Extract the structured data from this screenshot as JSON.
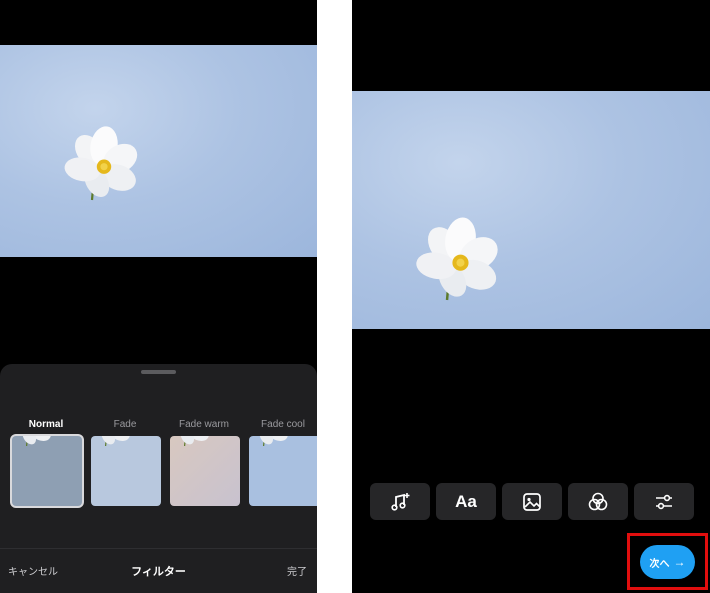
{
  "filter_editor": {
    "filters": [
      {
        "label": "Normal",
        "selected": true
      },
      {
        "label": "Fade",
        "selected": false
      },
      {
        "label": "Fade warm",
        "selected": false
      },
      {
        "label": "Fade cool",
        "selected": false
      }
    ],
    "cancel_label": "キャンセル",
    "title": "フィルター",
    "done_label": "完了"
  },
  "story_editor": {
    "tools": [
      {
        "icon": "music-note-add-icon"
      },
      {
        "icon": "text-icon",
        "text": "Aa"
      },
      {
        "icon": "sticker-image-icon"
      },
      {
        "icon": "effects-circles-icon"
      },
      {
        "icon": "sliders-adjust-icon"
      }
    ],
    "next_label": "次へ",
    "next_arrow": "→"
  },
  "colors": {
    "sky": "#adc3e3",
    "next_button": "#1fa0f3",
    "highlight": "#e10e0e"
  }
}
